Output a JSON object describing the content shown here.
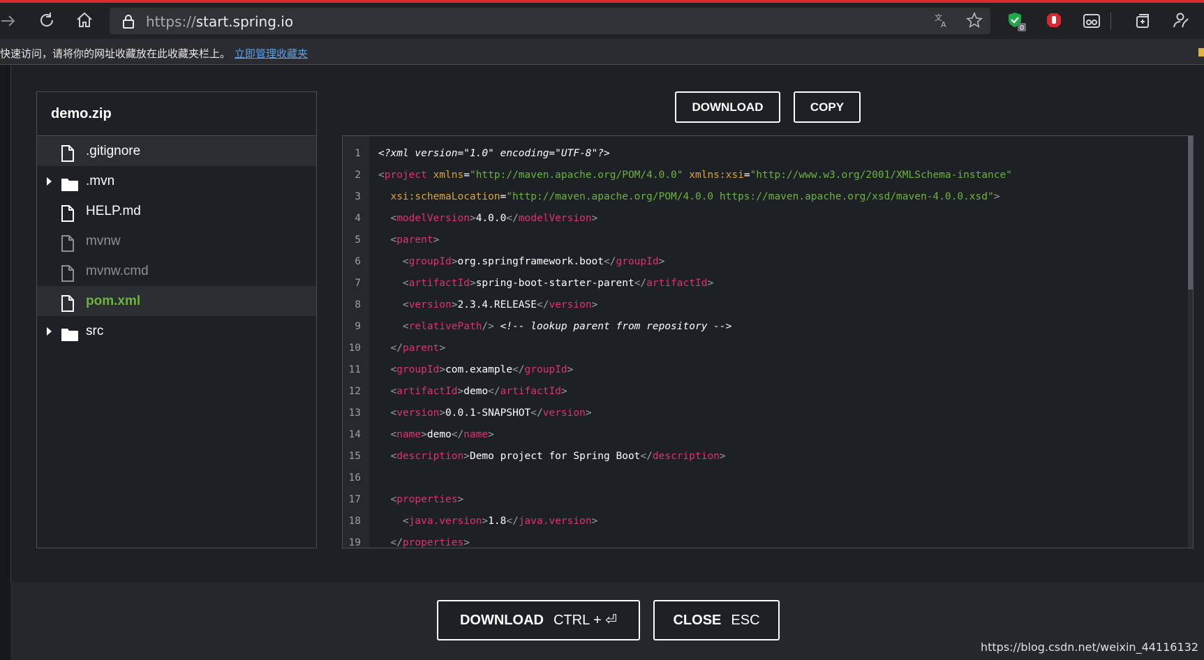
{
  "browser": {
    "url_scheme": "https://",
    "url_host": "start.spring.io",
    "favorites_message": "快速访问，请将你的网址收藏放在此收藏夹栏上。",
    "favorites_link": "立即管理收藏夹",
    "extension_badge": "0",
    "icons": [
      "forward-icon",
      "refresh-icon",
      "home-icon",
      "lock-icon",
      "translate-icon",
      "star-icon",
      "shield-check-icon",
      "stop-hand-icon",
      "glasses-icon",
      "collections-icon",
      "feedback-icon"
    ]
  },
  "tree": {
    "title": "demo.zip",
    "items": [
      {
        "label": ".gitignore",
        "type": "file"
      },
      {
        "label": ".mvn",
        "type": "folder"
      },
      {
        "label": "HELP.md",
        "type": "file"
      },
      {
        "label": "mvnw",
        "type": "file"
      },
      {
        "label": "mvnw.cmd",
        "type": "file"
      },
      {
        "label": "pom.xml",
        "type": "file"
      },
      {
        "label": "src",
        "type": "folder"
      }
    ]
  },
  "actions": {
    "download": "DOWNLOAD",
    "copy": "COPY"
  },
  "code": {
    "line_numbers": [
      "1",
      "2",
      "3",
      "4",
      "5",
      "6",
      "7",
      "8",
      "9",
      "10",
      "11",
      "12",
      "13",
      "14",
      "15",
      "16",
      "17",
      "18",
      "19"
    ],
    "lines": [
      "<?xml version=\"1.0\" encoding=\"UTF-8\"?>",
      "<project xmlns=\"http://maven.apache.org/POM/4.0.0\" xmlns:xsi=\"http://www.w3.org/2001/XMLSchema-instance\"",
      "  xsi:schemaLocation=\"http://maven.apache.org/POM/4.0.0 https://maven.apache.org/xsd/maven-4.0.0.xsd\">",
      "  <modelVersion>4.0.0</modelVersion>",
      "  <parent>",
      "    <groupId>org.springframework.boot</groupId>",
      "    <artifactId>spring-boot-starter-parent</artifactId>",
      "    <version>2.3.4.RELEASE</version>",
      "    <relativePath/> <!-- lookup parent from repository -->",
      "  </parent>",
      "  <groupId>com.example</groupId>",
      "  <artifactId>demo</artifactId>",
      "  <version>0.0.1-SNAPSHOT</version>",
      "  <name>demo</name>",
      "  <description>Demo project for Spring Boot</description>",
      "",
      "  <properties>",
      "    <java.version>1.8</java.version>",
      "  </properties>"
    ]
  },
  "footer": {
    "download_label": "DOWNLOAD",
    "download_shortcut": "CTRL + ⏎",
    "close_label": "CLOSE",
    "close_shortcut": "ESC"
  },
  "watermark": "https://blog.csdn.net/weixin_44116132",
  "colors": {
    "accent_green": "#6db33f",
    "tag_pink": "#e0336e",
    "attr_gold": "#d9a441",
    "background": "#1d2024"
  }
}
